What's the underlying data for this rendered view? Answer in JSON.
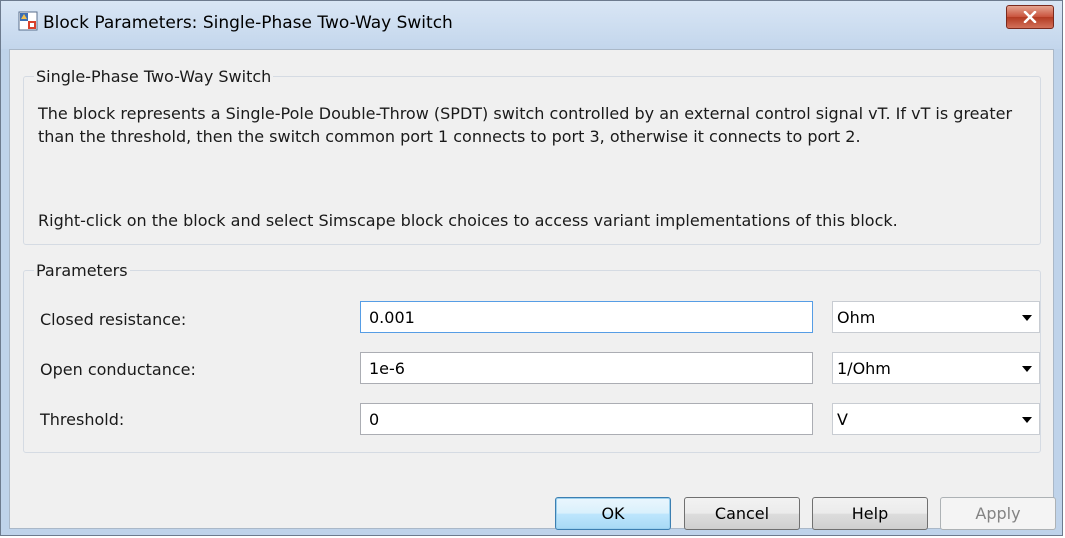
{
  "window": {
    "title": "Block Parameters: Single-Phase Two-Way Switch",
    "close_icon": "close-x-icon",
    "app_icon": "simulink-block-icon"
  },
  "description": {
    "legend": "Single-Phase Two-Way Switch",
    "paragraph1": "The block represents a Single-Pole Double-Throw (SPDT) switch controlled by an external control signal vT. If vT is greater than the threshold, then the switch common port 1 connects to port 3, otherwise it connects to port 2.",
    "paragraph2": "Right-click on the block and select Simscape block choices to access variant implementations of this block."
  },
  "parameters": {
    "legend": "Parameters",
    "rows": [
      {
        "label": "Closed resistance:",
        "value": "0.001",
        "unit": "Ohm"
      },
      {
        "label": "Open conductance:",
        "value": "1e-6",
        "unit": "1/Ohm"
      },
      {
        "label": "Threshold:",
        "value": "0",
        "unit": "V"
      }
    ]
  },
  "buttons": {
    "ok": "OK",
    "cancel": "Cancel",
    "help": "Help",
    "apply": "Apply"
  }
}
